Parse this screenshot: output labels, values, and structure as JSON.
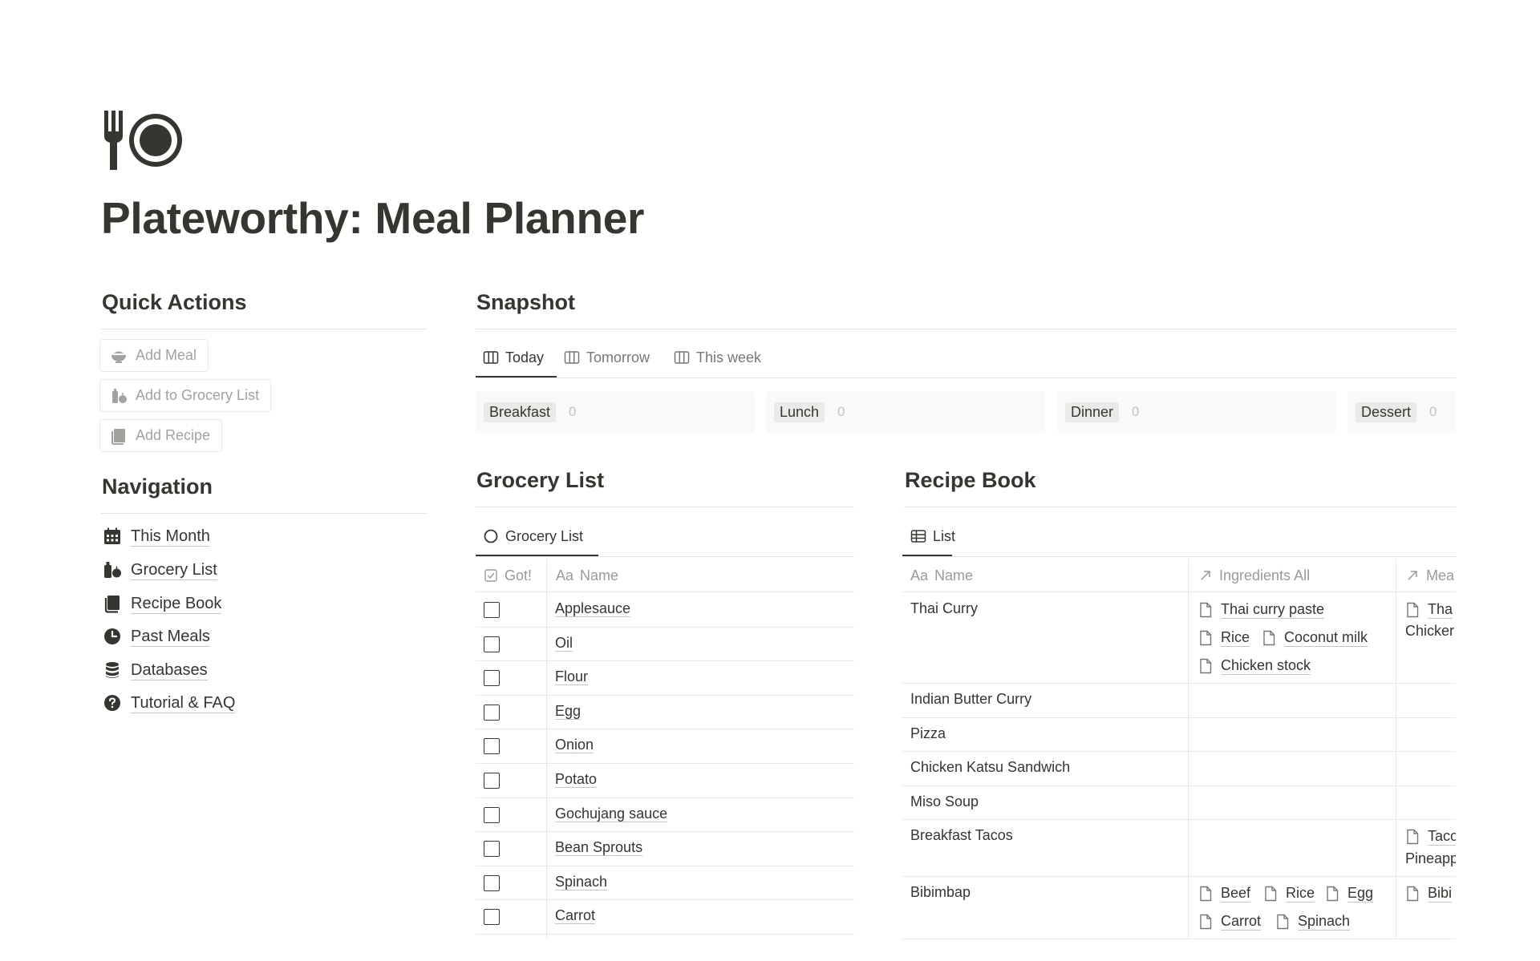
{
  "page": {
    "title": "Plateworthy: Meal Planner",
    "icon": "fork-plate-icon"
  },
  "quick_actions": {
    "heading": "Quick Actions",
    "buttons": [
      {
        "label": "Add Meal",
        "icon": "bowl-icon"
      },
      {
        "label": "Add to Grocery List",
        "icon": "grocery-icon"
      },
      {
        "label": "Add Recipe",
        "icon": "book-icon"
      }
    ]
  },
  "navigation": {
    "heading": "Navigation",
    "items": [
      {
        "label": "This Month",
        "icon": "calendar-icon"
      },
      {
        "label": "Grocery List",
        "icon": "grocery-icon"
      },
      {
        "label": "Recipe Book",
        "icon": "book-icon"
      },
      {
        "label": "Past Meals",
        "icon": "clock-icon"
      },
      {
        "label": "Databases",
        "icon": "database-icon"
      },
      {
        "label": "Tutorial & FAQ",
        "icon": "question-icon"
      }
    ]
  },
  "snapshot": {
    "heading": "Snapshot",
    "tabs": [
      {
        "label": "Today",
        "active": true
      },
      {
        "label": "Tomorrow",
        "active": false
      },
      {
        "label": "This week",
        "active": false
      }
    ],
    "columns": [
      {
        "label": "Breakfast",
        "count": "0"
      },
      {
        "label": "Lunch",
        "count": "0"
      },
      {
        "label": "Dinner",
        "count": "0"
      },
      {
        "label": "Dessert",
        "count": "0"
      }
    ]
  },
  "grocery": {
    "heading": "Grocery List",
    "view_tab": "Grocery List",
    "col_got": "Got!",
    "col_name": "Name",
    "col_name_prefix": "Aa",
    "items": [
      "Applesauce",
      "Oil",
      "Flour",
      "Egg",
      "Onion",
      "Potato",
      "Gochujang sauce",
      "Bean Sprouts",
      "Spinach",
      "Carrot"
    ]
  },
  "recipes": {
    "heading": "Recipe Book",
    "view_tab": "List",
    "col_name": "Name",
    "col_name_prefix": "Aa",
    "col_ingredients": "Ingredients All",
    "col_meals": "Mea",
    "rows": [
      {
        "name": "Thai Curry"
      },
      {
        "name": "Indian Butter Curry"
      },
      {
        "name": "Pizza"
      },
      {
        "name": "Chicken Katsu Sandwich"
      },
      {
        "name": "Miso Soup"
      },
      {
        "name": "Breakfast Tacos"
      },
      {
        "name": "Bibimbap"
      }
    ],
    "thai_ingredients": [
      "Thai curry paste",
      "Rice",
      "Coconut milk",
      "Chicken stock"
    ],
    "thai_meals": [
      "Tha",
      "Chicker"
    ],
    "tacos_meals": [
      "Taco",
      "Pineapp"
    ],
    "bibimbap_ingredients": [
      "Beef",
      "Rice",
      "Egg",
      "Carrot",
      "Spinach"
    ],
    "bibimbap_meals": [
      "Bibi"
    ]
  },
  "colors": {
    "text": "#37352f",
    "muted": "#9b9a97",
    "border": "#e9e9e7"
  }
}
